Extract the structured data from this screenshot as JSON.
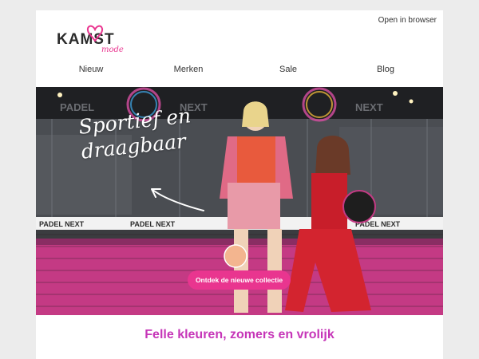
{
  "header": {
    "logo_text_main": "KAMST",
    "logo_text_sub": "mode",
    "open_in_browser": "Open in browser"
  },
  "nav": {
    "items": [
      {
        "label": "Nieuw"
      },
      {
        "label": "Merken"
      },
      {
        "label": "Sale"
      },
      {
        "label": "Blog"
      }
    ]
  },
  "hero": {
    "script_line1": "Sportief en",
    "script_line2": "draagbaar",
    "net_brand": "PADEL NEXT",
    "cta_label": "Ontdek de nieuwe collectie"
  },
  "content": {
    "headline": "Felle kleuren, zomers en vrolijk"
  },
  "colors": {
    "accent_pink": "#e9358f",
    "headline_magenta": "#c636b8",
    "court_pink": "#c43a84",
    "logo_dark": "#2b2b2b"
  }
}
